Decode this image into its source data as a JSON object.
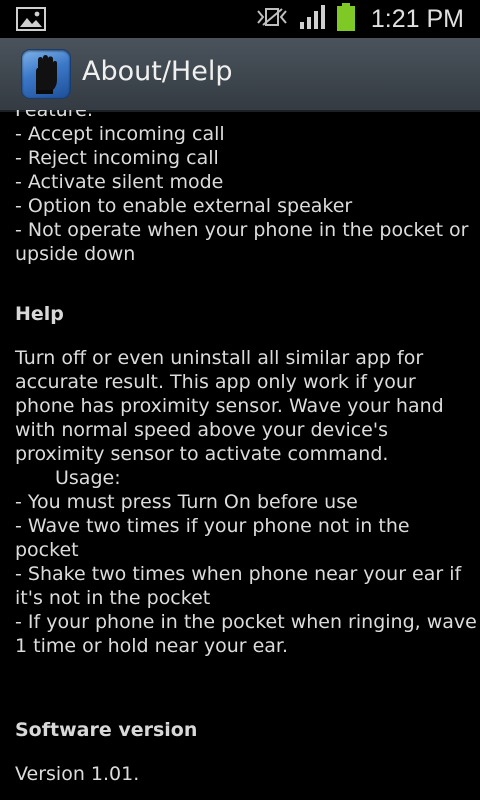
{
  "status_bar": {
    "time": "1:21 PM",
    "icons": [
      "gallery-notification-icon",
      "no-signal-vibrate-icon",
      "signal-bars-icon",
      "battery-charging-icon"
    ]
  },
  "action_bar": {
    "title": "About/Help",
    "icon": "glove-hand-icon",
    "accent": "#3c78c8"
  },
  "features": {
    "heading_partial": "Feature:",
    "items": [
      "- Accept incoming call",
      "- Reject incoming call",
      "- Activate silent mode",
      "- Option to enable external speaker",
      "- Not operate when your phone in the pocket or",
      "upside down"
    ]
  },
  "help": {
    "heading": "Help",
    "lines": [
      "Turn off or even uninstall all similar app for",
      "accurate result. This app only work if your",
      "phone has proximity sensor. Wave your hand",
      "with normal speed above your device's",
      "proximity sensor to activate command."
    ],
    "usage_label": "Usage:",
    "usage_lines": [
      "- You must press Turn On before use",
      "- Wave two times if your phone not in the",
      "pocket",
      "- Shake two times when phone near your ear if",
      "it's not in the pocket",
      "- If your phone in the pocket when ringing, wave",
      "1 time or hold near your ear."
    ]
  },
  "software": {
    "heading": "Software version",
    "version": "Version 1.01."
  }
}
